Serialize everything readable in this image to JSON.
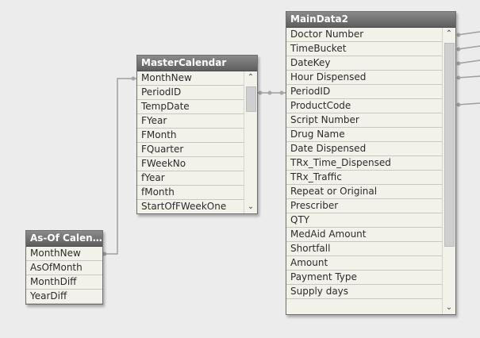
{
  "tables": {
    "as_of_calendar": {
      "title": "As-Of Calen...",
      "fields": [
        "MonthNew",
        "AsOfMonth",
        "MonthDiff",
        "YearDiff"
      ]
    },
    "master_calendar": {
      "title": "MasterCalendar",
      "fields": [
        "MonthNew",
        "PeriodID",
        "TempDate",
        "FYear",
        "FMonth",
        "FQuarter",
        "FWeekNo",
        "fYear",
        "fMonth",
        "StartOfFWeekOne"
      ]
    },
    "main_data2": {
      "title": "MainData2",
      "fields": [
        "Doctor Number",
        "TimeBucket",
        "DateKey",
        "Hour Dispensed",
        "PeriodID",
        "ProductCode",
        "Script Number",
        "Drug Name",
        "Date Dispensed",
        "TRx_Time_Dispensed",
        "TRx_Traffic",
        "Repeat or Original",
        "Prescriber",
        "QTY",
        "MedAid Amount",
        "Shortfall",
        "Amount",
        "Payment Type",
        "Supply days"
      ]
    }
  },
  "scroll": {
    "up_glyph": "⌃",
    "down_glyph": "⌄"
  }
}
